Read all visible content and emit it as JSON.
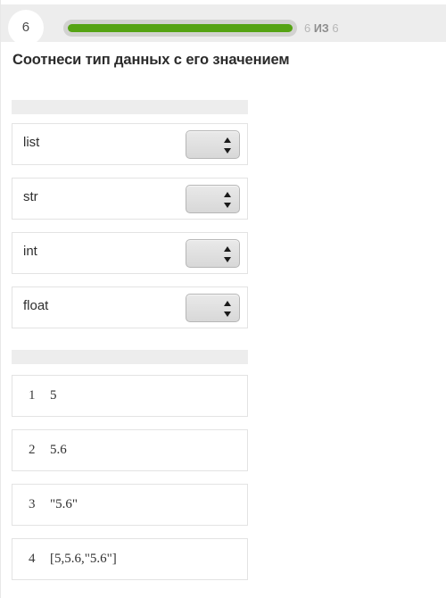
{
  "header": {
    "step_number": "6",
    "progress": {
      "current": "6",
      "total": "6",
      "separator": "из",
      "percent": 100
    }
  },
  "question": {
    "title": "Соотнеси тип данных с его значением"
  },
  "match_section": {
    "rows": [
      {
        "label": "list",
        "selected": ""
      },
      {
        "label": "str",
        "selected": ""
      },
      {
        "label": "int",
        "selected": ""
      },
      {
        "label": "float",
        "selected": ""
      }
    ]
  },
  "value_section": {
    "rows": [
      {
        "index": "1",
        "text": "5"
      },
      {
        "index": "2",
        "text": "5.6"
      },
      {
        "index": "3",
        "text": "\"5.6\""
      },
      {
        "index": "4",
        "text": "[5,5.6,\"5.6\"]"
      }
    ]
  },
  "colors": {
    "progress_fill": "#55a313",
    "progress_track": "#d2d2d0",
    "header_band": "#ededed",
    "row_border": "#e3e3e3",
    "text_primary": "#2e2e2e"
  }
}
